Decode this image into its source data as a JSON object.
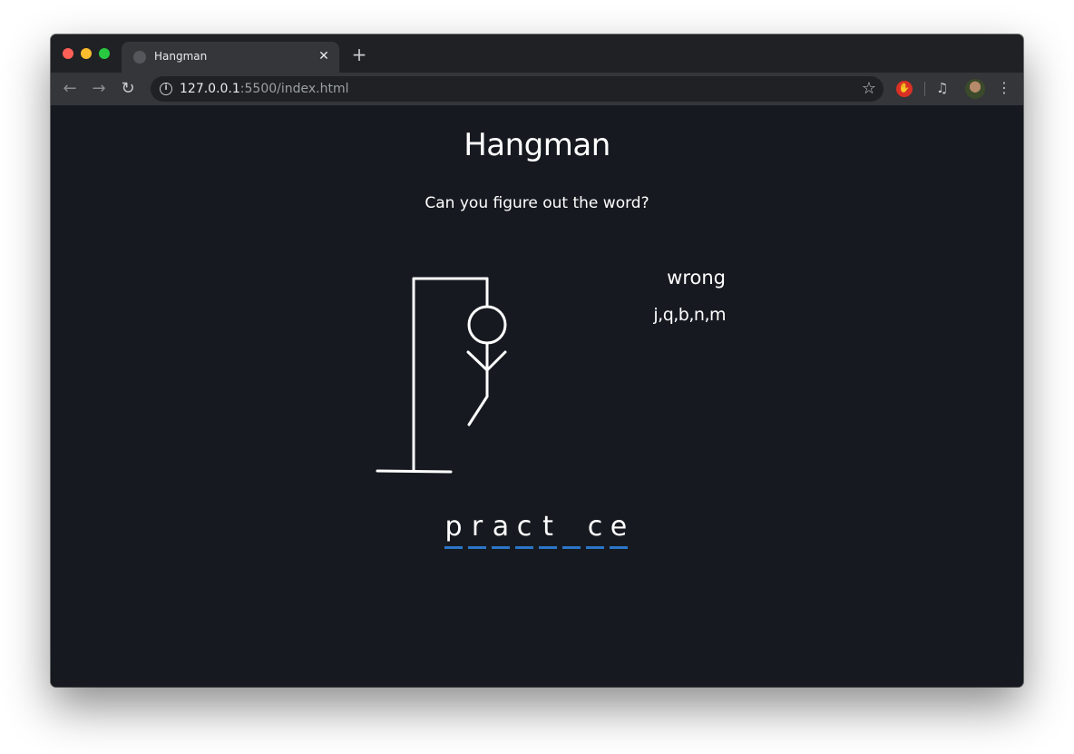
{
  "browser": {
    "tab_title": "Hangman",
    "tab_close": "✕",
    "new_tab": "+",
    "url_host": "127.0.0.1",
    "url_path": ":5500/index.html",
    "nav_back": "←",
    "nav_forward": "→",
    "nav_reload": "↻",
    "info_symbol": "i",
    "star": "☆",
    "menu": "⋮"
  },
  "game": {
    "title": "Hangman",
    "subtitle": "Can you figure out the word?",
    "wrong_label": "wrong",
    "wrong_letters": "j,q,b,n,m",
    "word_slots": [
      "p",
      "r",
      "a",
      "c",
      "t",
      "",
      "c",
      "e"
    ],
    "body_parts_shown": [
      "head",
      "left-arm",
      "right-arm",
      "torso",
      "left-leg"
    ]
  },
  "colors": {
    "page_background": "#161a20",
    "slot_underline": "#2b76c7",
    "figure": "#ffffff"
  }
}
